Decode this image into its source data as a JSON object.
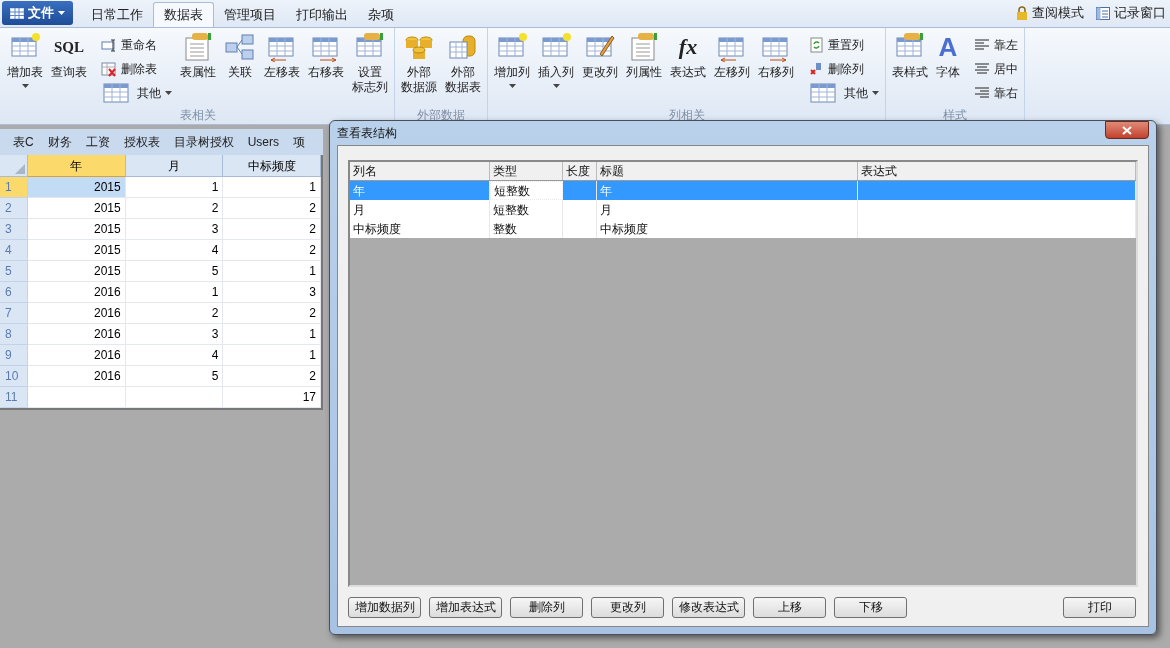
{
  "app_menu": {
    "file_button": "文件",
    "tabs": [
      {
        "label": "日常工作",
        "selected": false
      },
      {
        "label": "数据表",
        "selected": true
      },
      {
        "label": "管理项目",
        "selected": false
      },
      {
        "label": "打印输出",
        "selected": false
      },
      {
        "label": "杂项",
        "selected": false
      }
    ],
    "right_tools": [
      "查阅模式",
      "记录窗口"
    ]
  },
  "ribbon": {
    "groups": [
      {
        "label": "表相关",
        "items": [
          {
            "kind": "large",
            "label": "增加表",
            "dropdown": true
          },
          {
            "kind": "large",
            "label": "查询表",
            "icon_text": "SQL",
            "dropdown": false
          },
          {
            "kind": "stack",
            "items": [
              {
                "label": "重命名",
                "dropdown": false
              },
              {
                "label": "删除表",
                "dropdown": false
              },
              {
                "label": "其他",
                "dropdown": true
              }
            ]
          },
          {
            "kind": "large",
            "label": "表属性",
            "dropdown": false
          },
          {
            "kind": "large",
            "label": "关联",
            "dropdown": false
          },
          {
            "kind": "large",
            "label": "左移表",
            "dropdown": false
          },
          {
            "kind": "large",
            "label": "右移表",
            "dropdown": false
          },
          {
            "kind": "large",
            "label_lines": [
              "设置",
              "标志列"
            ],
            "dropdown": false
          }
        ]
      },
      {
        "label": "外部数据",
        "items": [
          {
            "kind": "large",
            "label_lines": [
              "外部",
              "数据源"
            ],
            "dropdown": false
          },
          {
            "kind": "large",
            "label_lines": [
              "外部",
              "数据表"
            ],
            "dropdown": false
          }
        ]
      },
      {
        "label": "列相关",
        "items": [
          {
            "kind": "large",
            "label": "增加列",
            "dropdown": true
          },
          {
            "kind": "large",
            "label": "插入列",
            "dropdown": true
          },
          {
            "kind": "large",
            "label": "更改列",
            "dropdown": false
          },
          {
            "kind": "large",
            "label": "列属性",
            "dropdown": false
          },
          {
            "kind": "large",
            "label": "表达式",
            "icon_text": "fx",
            "dropdown": false
          },
          {
            "kind": "large",
            "label": "左移列",
            "dropdown": false
          },
          {
            "kind": "large",
            "label": "右移列",
            "dropdown": false
          },
          {
            "kind": "stack",
            "items": [
              {
                "label": "重置列",
                "dropdown": false
              },
              {
                "label": "删除列",
                "dropdown": false
              },
              {
                "label": "其他",
                "dropdown": true
              }
            ]
          }
        ]
      },
      {
        "label": "样式",
        "items": [
          {
            "kind": "large",
            "label": "表样式",
            "dropdown": false
          },
          {
            "kind": "large",
            "label": "字体",
            "icon_text": "A",
            "dropdown": false
          },
          {
            "kind": "stack",
            "items": [
              {
                "label": "靠左",
                "dropdown": false
              },
              {
                "label": "居中",
                "dropdown": false
              },
              {
                "label": "靠右",
                "dropdown": false
              }
            ]
          }
        ]
      }
    ]
  },
  "table_tabs": [
    {
      "label": "表C",
      "selected": false
    },
    {
      "label": "财务",
      "selected": false
    },
    {
      "label": "工资",
      "selected": false
    },
    {
      "label": "授权表",
      "selected": false
    },
    {
      "label": "目录树授权",
      "selected": false
    },
    {
      "label": "Users",
      "selected": false
    },
    {
      "label": "项",
      "selected": false
    }
  ],
  "grid": {
    "columns": [
      {
        "label": "年",
        "selected": true
      },
      {
        "label": "月",
        "selected": false
      },
      {
        "label": "中标频度",
        "selected": false
      }
    ],
    "rows": [
      {
        "number": "1",
        "selected": true,
        "cells": [
          "2015",
          "1",
          "1"
        ]
      },
      {
        "number": "2",
        "selected": false,
        "cells": [
          "2015",
          "2",
          "2"
        ]
      },
      {
        "number": "3",
        "selected": false,
        "cells": [
          "2015",
          "3",
          "2"
        ]
      },
      {
        "number": "4",
        "selected": false,
        "cells": [
          "2015",
          "4",
          "2"
        ]
      },
      {
        "number": "5",
        "selected": false,
        "cells": [
          "2015",
          "5",
          "1"
        ]
      },
      {
        "number": "6",
        "selected": false,
        "cells": [
          "2016",
          "1",
          "3"
        ]
      },
      {
        "number": "7",
        "selected": false,
        "cells": [
          "2016",
          "2",
          "2"
        ]
      },
      {
        "number": "8",
        "selected": false,
        "cells": [
          "2016",
          "3",
          "1"
        ]
      },
      {
        "number": "9",
        "selected": false,
        "cells": [
          "2016",
          "4",
          "1"
        ]
      },
      {
        "number": "10",
        "selected": false,
        "cells": [
          "2016",
          "5",
          "2"
        ]
      },
      {
        "number": "11",
        "selected": false,
        "cells": [
          "",
          "",
          "17"
        ]
      }
    ]
  },
  "dialog": {
    "title": "查看表结构",
    "columns": [
      "列名",
      "类型",
      "长度",
      "标题",
      "表达式"
    ],
    "rows": [
      {
        "selected": true,
        "cells": [
          "年",
          "短整数",
          "",
          "年",
          ""
        ]
      },
      {
        "selected": false,
        "cells": [
          "月",
          "短整数",
          "",
          "月",
          ""
        ]
      },
      {
        "selected": false,
        "cells": [
          "中标频度",
          "整数",
          "",
          "中标频度",
          ""
        ]
      }
    ],
    "buttons": [
      "增加数据列",
      "增加表达式",
      "删除列",
      "更改列",
      "修改表达式",
      "上移",
      "下移"
    ],
    "print_button": "打印"
  }
}
